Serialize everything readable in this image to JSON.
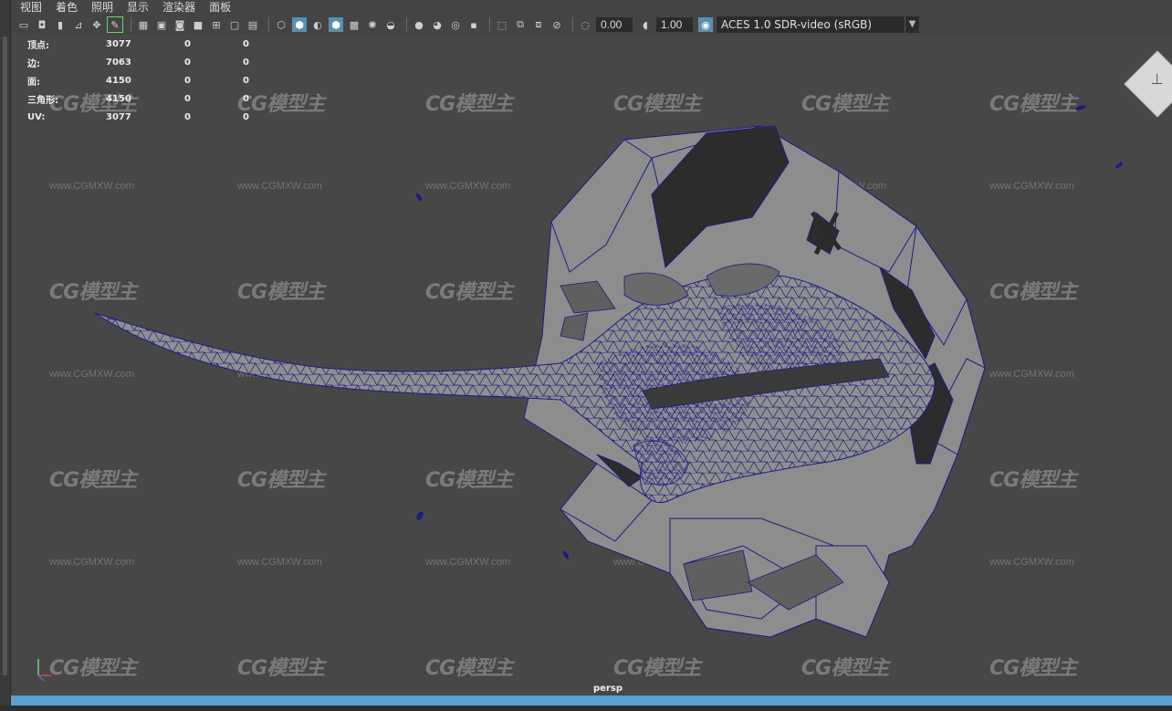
{
  "menubar": {
    "items": [
      "视图",
      "着色",
      "照明",
      "显示",
      "渲染器",
      "面板"
    ]
  },
  "toolbar": {
    "exposure": "0.00",
    "gamma": "1.00",
    "color_management": "ACES 1.0 SDR-video (sRGB)"
  },
  "hud": {
    "rows": [
      {
        "label": "顶点:",
        "v1": "3077",
        "v2": "0",
        "v3": "0"
      },
      {
        "label": "边:",
        "v1": "7063",
        "v2": "0",
        "v3": "0"
      },
      {
        "label": "面:",
        "v1": "4150",
        "v2": "0",
        "v3": "0"
      },
      {
        "label": "三角形:",
        "v1": "4150",
        "v2": "0",
        "v3": "0"
      },
      {
        "label": "UV:",
        "v1": "3077",
        "v2": "0",
        "v3": "0"
      }
    ]
  },
  "viewport": {
    "camera": "persp",
    "watermark_logo": "CG模型主",
    "watermark_url": "www.CGMXW.com"
  },
  "colors": {
    "viewport_bg": "#474747",
    "wireframe": "#1a1a7a",
    "mesh_fill": "#8c8c8c",
    "timeline_bar": "#5ba0d0"
  }
}
